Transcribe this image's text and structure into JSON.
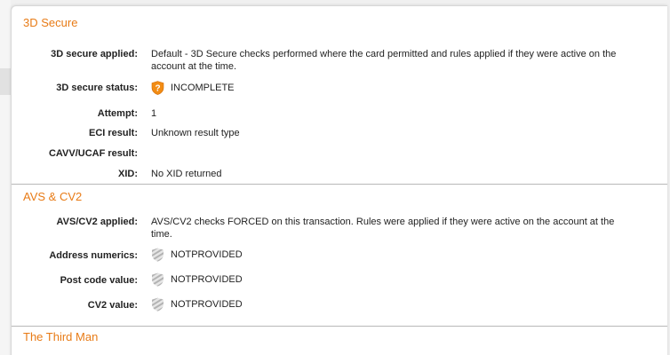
{
  "colors": {
    "accent": "#e87b16",
    "warning_icon": "#f28c14",
    "neutral_icon": "#bdbdbd"
  },
  "secure_3d": {
    "title": "3D Secure",
    "rows": [
      {
        "label": "3D secure applied:",
        "value": "Default - 3D Secure checks performed where the card permitted and rules applied if they were active on the account at the time."
      },
      {
        "label": "3D secure status:",
        "value": "INCOMPLETE",
        "icon": "warning-shield-icon"
      },
      {
        "label": "Attempt:",
        "value": "1"
      },
      {
        "label": "ECI result:",
        "value": "Unknown result type"
      },
      {
        "label": "CAVV/UCAF result:",
        "value": ""
      },
      {
        "label": "XID:",
        "value": "No XID returned"
      }
    ]
  },
  "avs_cv2": {
    "title": "AVS & CV2",
    "rows": [
      {
        "label": "AVS/CV2 applied:",
        "value": "AVS/CV2 checks FORCED on this transaction. Rules were applied if they were active on the account at the time."
      },
      {
        "label": "Address numerics:",
        "value": "NOTPROVIDED",
        "icon": "not-provided-shield-icon"
      },
      {
        "label": "Post code value:",
        "value": "NOTPROVIDED",
        "icon": "not-provided-shield-icon"
      },
      {
        "label": "CV2 value:",
        "value": "NOTPROVIDED",
        "icon": "not-provided-shield-icon"
      }
    ]
  },
  "third_man": {
    "title": "The Third Man"
  }
}
